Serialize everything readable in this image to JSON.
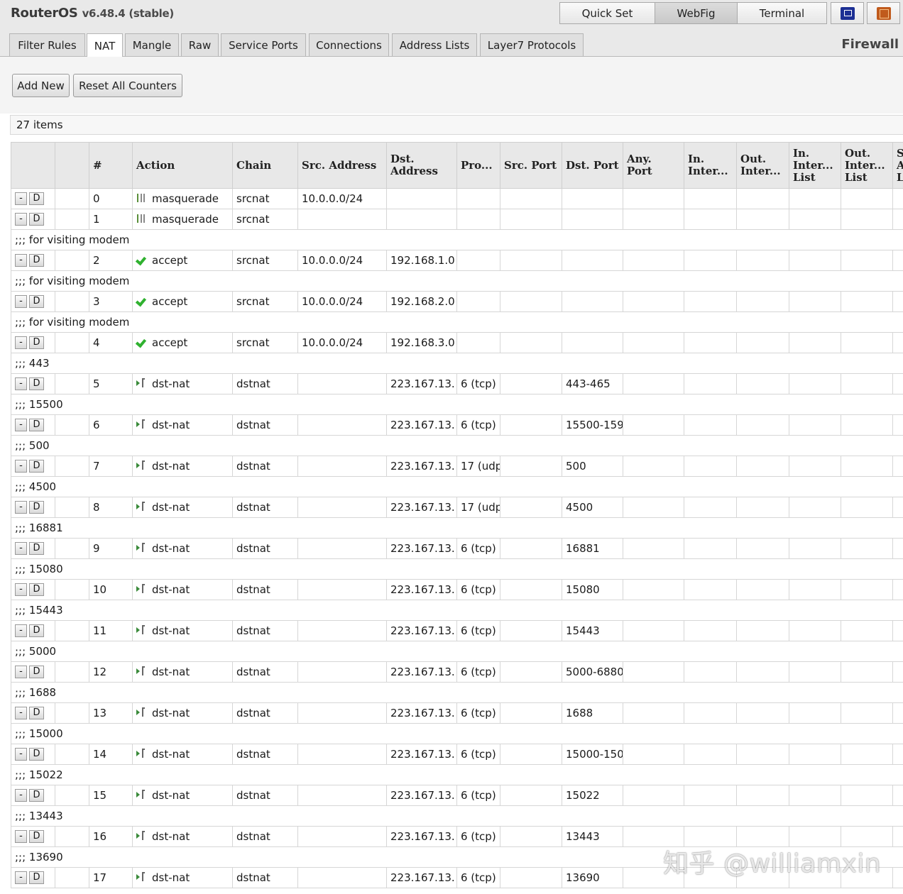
{
  "header": {
    "brand": "RouterOS",
    "version": "v6.48.4 (stable)",
    "buttons": {
      "quick_set": "Quick Set",
      "webfig": "WebFig",
      "terminal": "Terminal"
    },
    "icons": [
      "winbox-icon",
      "design-skin-icon"
    ]
  },
  "tabs": [
    "Filter Rules",
    "NAT",
    "Mangle",
    "Raw",
    "Service Ports",
    "Connections",
    "Address Lists",
    "Layer7 Protocols"
  ],
  "active_tab": "NAT",
  "section_title": "Firewall",
  "toolbar": {
    "add_new": "Add New",
    "reset_counters": "Reset All Counters"
  },
  "item_count": "27 items",
  "row_buttons": {
    "remove": "-",
    "disable": "D"
  },
  "columns": [
    "",
    "",
    "#",
    "Action",
    "Chain",
    "Src. Address",
    "Dst. Address",
    "Pro...",
    "Src. Port",
    "Dst. Port",
    "Any. Port",
    "In. Inter...",
    "Out. Inter...",
    "In. Inter... List",
    "Out. Inter... List",
    "S A L"
  ],
  "rows": [
    {
      "comment": "",
      "num": "0",
      "action": "masquerade",
      "icon": "masq",
      "chain": "srcnat",
      "src": "10.0.0.0/24",
      "dst": "",
      "proto": "",
      "sport": "",
      "dport": ""
    },
    {
      "comment": "",
      "num": "1",
      "action": "masquerade",
      "icon": "masq",
      "chain": "srcnat",
      "src": "",
      "dst": "",
      "proto": "",
      "sport": "",
      "dport": ""
    },
    {
      "comment": ";;; for visiting modem",
      "num": "2",
      "action": "accept",
      "icon": "accept",
      "chain": "srcnat",
      "src": "10.0.0.0/24",
      "dst": "192.168.1.0",
      "proto": "",
      "sport": "",
      "dport": ""
    },
    {
      "comment": ";;; for visiting modem",
      "num": "3",
      "action": "accept",
      "icon": "accept",
      "chain": "srcnat",
      "src": "10.0.0.0/24",
      "dst": "192.168.2.0",
      "proto": "",
      "sport": "",
      "dport": ""
    },
    {
      "comment": ";;; for visiting modem",
      "num": "4",
      "action": "accept",
      "icon": "accept",
      "chain": "srcnat",
      "src": "10.0.0.0/24",
      "dst": "192.168.3.0",
      "proto": "",
      "sport": "",
      "dport": ""
    },
    {
      "comment": ";;; 443",
      "num": "5",
      "action": "dst-nat",
      "icon": "dnat",
      "chain": "dstnat",
      "src": "",
      "dst": "223.167.13.",
      "proto": "6 (tcp)",
      "sport": "",
      "dport": "443-465"
    },
    {
      "comment": ";;; 15500",
      "num": "6",
      "action": "dst-nat",
      "icon": "dnat",
      "chain": "dstnat",
      "src": "",
      "dst": "223.167.13.",
      "proto": "6 (tcp)",
      "sport": "",
      "dport": "15500-159"
    },
    {
      "comment": ";;; 500",
      "num": "7",
      "action": "dst-nat",
      "icon": "dnat",
      "chain": "dstnat",
      "src": "",
      "dst": "223.167.13.",
      "proto": "17 (udp",
      "sport": "",
      "dport": "500"
    },
    {
      "comment": ";;; 4500",
      "num": "8",
      "action": "dst-nat",
      "icon": "dnat",
      "chain": "dstnat",
      "src": "",
      "dst": "223.167.13.",
      "proto": "17 (udp",
      "sport": "",
      "dport": "4500"
    },
    {
      "comment": ";;; 16881",
      "num": "9",
      "action": "dst-nat",
      "icon": "dnat",
      "chain": "dstnat",
      "src": "",
      "dst": "223.167.13.",
      "proto": "6 (tcp)",
      "sport": "",
      "dport": "16881"
    },
    {
      "comment": ";;; 15080",
      "num": "10",
      "action": "dst-nat",
      "icon": "dnat",
      "chain": "dstnat",
      "src": "",
      "dst": "223.167.13.",
      "proto": "6 (tcp)",
      "sport": "",
      "dport": "15080"
    },
    {
      "comment": ";;; 15443",
      "num": "11",
      "action": "dst-nat",
      "icon": "dnat",
      "chain": "dstnat",
      "src": "",
      "dst": "223.167.13.",
      "proto": "6 (tcp)",
      "sport": "",
      "dport": "15443"
    },
    {
      "comment": ";;; 5000",
      "num": "12",
      "action": "dst-nat",
      "icon": "dnat",
      "chain": "dstnat",
      "src": "",
      "dst": "223.167.13.",
      "proto": "6 (tcp)",
      "sport": "",
      "dport": "5000-6880"
    },
    {
      "comment": ";;; 1688",
      "num": "13",
      "action": "dst-nat",
      "icon": "dnat",
      "chain": "dstnat",
      "src": "",
      "dst": "223.167.13.",
      "proto": "6 (tcp)",
      "sport": "",
      "dport": "1688"
    },
    {
      "comment": ";;; 15000",
      "num": "14",
      "action": "dst-nat",
      "icon": "dnat",
      "chain": "dstnat",
      "src": "",
      "dst": "223.167.13.",
      "proto": "6 (tcp)",
      "sport": "",
      "dport": "15000-150"
    },
    {
      "comment": ";;; 15022",
      "num": "15",
      "action": "dst-nat",
      "icon": "dnat",
      "chain": "dstnat",
      "src": "",
      "dst": "223.167.13.",
      "proto": "6 (tcp)",
      "sport": "",
      "dport": "15022"
    },
    {
      "comment": ";;; 13443",
      "num": "16",
      "action": "dst-nat",
      "icon": "dnat",
      "chain": "dstnat",
      "src": "",
      "dst": "223.167.13.",
      "proto": "6 (tcp)",
      "sport": "",
      "dport": "13443"
    },
    {
      "comment": ";;; 13690",
      "num": "17",
      "action": "dst-nat",
      "icon": "dnat",
      "chain": "dstnat",
      "src": "",
      "dst": "223.167.13.",
      "proto": "6 (tcp)",
      "sport": "",
      "dport": "13690"
    }
  ],
  "watermark": "知乎 @williamxin"
}
